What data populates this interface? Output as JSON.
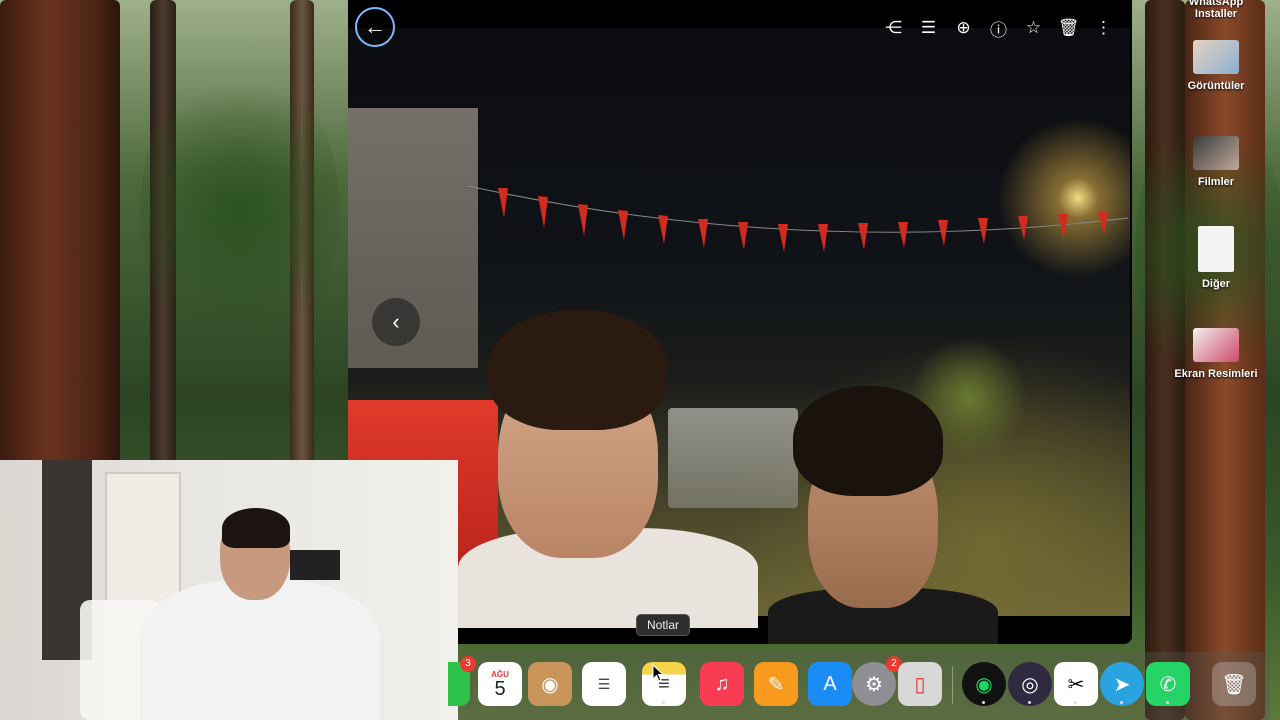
{
  "desktop": {
    "icons": [
      {
        "label": "WhatsApp\nInstaller"
      },
      {
        "label": "Görüntüler"
      },
      {
        "label": "Filmler"
      },
      {
        "label": "Diğer"
      },
      {
        "label": "Ekran Resimleri"
      }
    ]
  },
  "viewer": {
    "toolbar": [
      {
        "icon": "share-icon",
        "glyph": "⋲"
      },
      {
        "icon": "adjust-icon",
        "glyph": "☰"
      },
      {
        "icon": "zoom-icon",
        "glyph": "⊕"
      },
      {
        "icon": "info-icon",
        "glyph": "ⓘ"
      },
      {
        "icon": "star-icon",
        "glyph": "☆"
      },
      {
        "icon": "trash-icon",
        "glyph": "🗑"
      },
      {
        "icon": "more-icon",
        "glyph": "⋮"
      }
    ],
    "back_glyph": "←",
    "prev_glyph": "‹"
  },
  "tooltip": {
    "text": "Notlar"
  },
  "dock": {
    "calendar_month": "AĞU",
    "calendar_day": "5",
    "messages_badge": "3",
    "settings_badge": "2"
  }
}
